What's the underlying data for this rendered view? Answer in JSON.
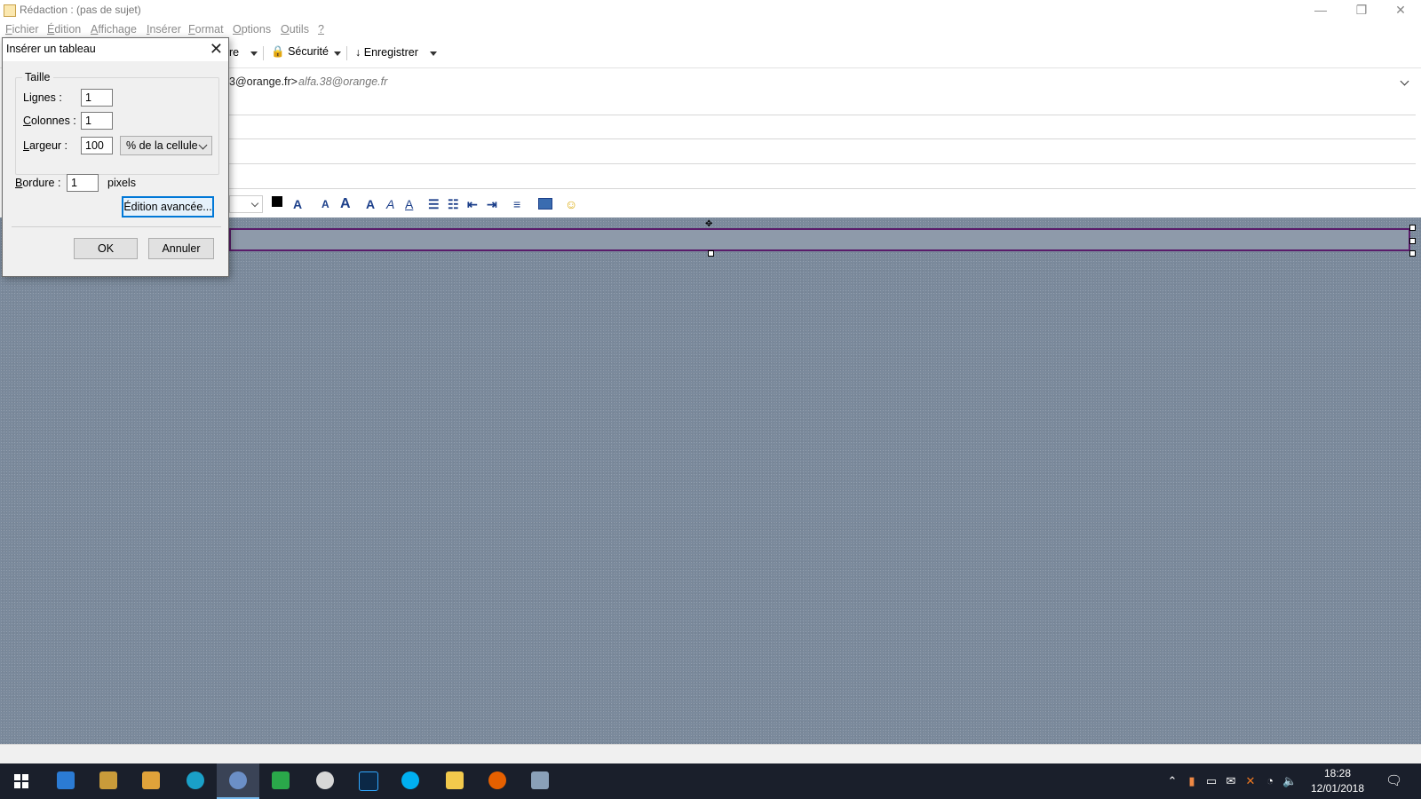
{
  "window": {
    "title": "Rédaction : (pas de sujet)",
    "minimize": "—",
    "restore": "❐",
    "close": "✕"
  },
  "menu": [
    {
      "pre": "",
      "ul": "F",
      "post": "ichier"
    },
    {
      "pre": "",
      "ul": "É",
      "post": "dition"
    },
    {
      "pre": "",
      "ul": "A",
      "post": "ffichage"
    },
    {
      "pre": "",
      "ul": "I",
      "post": "nsérer"
    },
    {
      "pre": "",
      "ul": "F",
      "post": "ormat"
    },
    {
      "pre": "",
      "ul": "O",
      "post": "ptions"
    },
    {
      "pre": "",
      "ul": "O",
      "post": "utils"
    },
    {
      "pre": "",
      "ul": "?",
      "post": ""
    }
  ],
  "toolbar": {
    "partial_label": "re",
    "security_label": "Sécurité",
    "save_label": "Enregistrer"
  },
  "headers": {
    "from_visible": "3@orange.fr>",
    "from_identity": "alfa.38@orange.fr"
  },
  "format_icons": [
    "A",
    "A",
    "A",
    "A",
    "A"
  ],
  "dialog": {
    "title": "Insérer un tableau",
    "close": "✕",
    "group_label": "Taille",
    "rows": {
      "pre": "Li",
      "ul": "g",
      "post": "nes :",
      "value": "1"
    },
    "cols": {
      "pre": "",
      "ul": "C",
      "post": "olonnes :",
      "value": "1"
    },
    "width": {
      "pre": "",
      "ul": "L",
      "post": "argeur :",
      "value": "100",
      "unit": "% de la cellule"
    },
    "border": {
      "pre": "",
      "ul": "B",
      "post": "ordure :",
      "value": "1",
      "unit": "pixels"
    },
    "advanced_label": "Édition avancée...",
    "ok_label": "OK",
    "cancel_label": "Annuler"
  },
  "taskbar": {
    "time": "18:28",
    "date": "12/01/2018"
  }
}
